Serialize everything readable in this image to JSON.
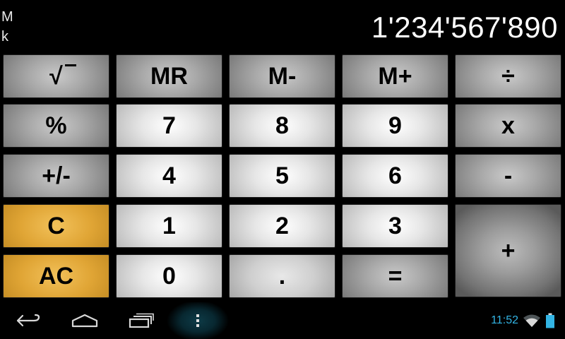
{
  "display": {
    "indicators": [
      "M",
      "k"
    ],
    "value": "1'234'567'890"
  },
  "keys": {
    "sqrt": "√",
    "mr": "MR",
    "mminus": "M-",
    "mplus": "M+",
    "divide": "÷",
    "percent": "%",
    "seven": "7",
    "eight": "8",
    "nine": "9",
    "multiply": "x",
    "negate": "+/-",
    "four": "4",
    "five": "5",
    "six": "6",
    "subtract": "-",
    "clear": "C",
    "one": "1",
    "two": "2",
    "three": "3",
    "add": "+",
    "all_clear": "AC",
    "zero": "0",
    "decimal": ".",
    "equals": "="
  },
  "navbar": {
    "icons": [
      "back-icon",
      "home-icon",
      "recent-apps-icon",
      "menu-icon"
    ]
  },
  "status_bar": {
    "time": "11:52",
    "icons": [
      "wifi-icon",
      "battery-icon"
    ],
    "accent_color": "#33b5e5"
  },
  "colors": {
    "background": "#000000",
    "light_key": "#e6e6e6",
    "dark_key": "#8a8a8a",
    "clear_key": "#e0a535"
  }
}
